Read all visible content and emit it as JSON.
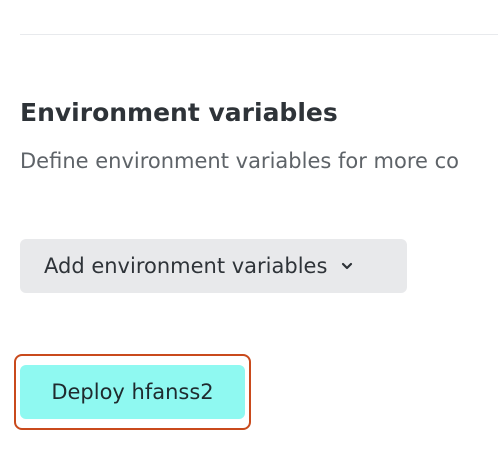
{
  "env_section": {
    "title": "Environment variables",
    "description": "Define environment variables for more co",
    "add_button_label": "Add environment variables",
    "add_button_icon": "chevron-down-icon"
  },
  "deploy": {
    "button_label": "Deploy hfanss2",
    "button_color": "#8ff9f1",
    "focus_ring_color": "#c94a1c"
  }
}
